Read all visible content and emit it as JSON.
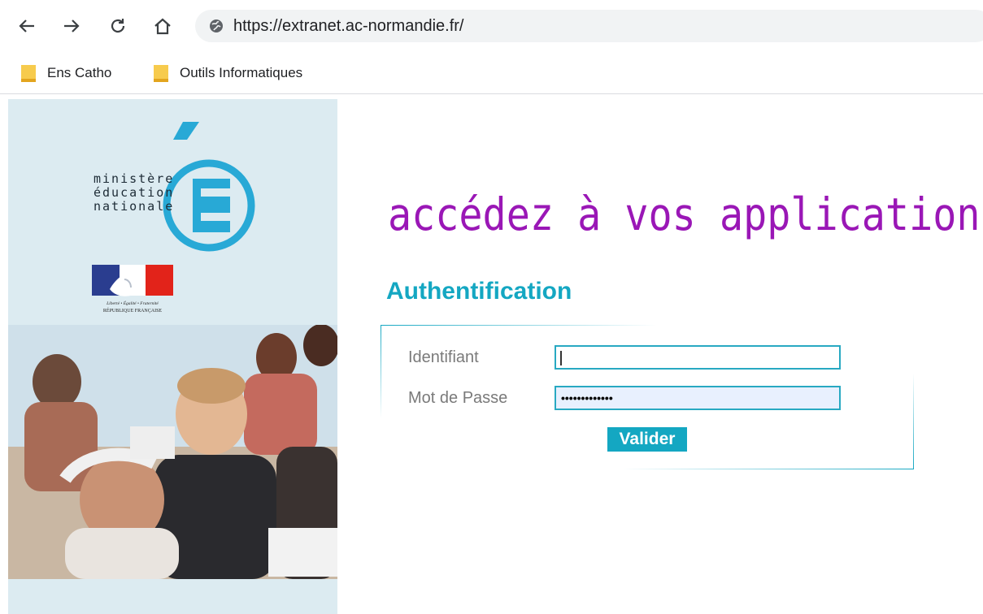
{
  "browser": {
    "url": "https://extranet.ac-normandie.fr/",
    "nav_icons": [
      "back-arrow-icon",
      "forward-arrow-icon",
      "reload-icon",
      "home-icon"
    ],
    "site_icon": "page-info-icon"
  },
  "bookmarks": [
    {
      "label": "Ens Catho",
      "icon": "folder-icon"
    },
    {
      "label": "Outils Informatiques",
      "icon": "folder-icon"
    }
  ],
  "logo": {
    "lines": [
      "ministère",
      "éducation",
      "nationale"
    ],
    "letter": "É",
    "republique": {
      "motto": "Liberté • Égalité • Fraternité",
      "name": "RÉPUBLIQUE FRANÇAISE"
    }
  },
  "main": {
    "headline": "accédez à vos applications",
    "auth_title": "Authentification",
    "form": {
      "username_label": "Identifiant",
      "username_value": "",
      "password_label": "Mot de Passe",
      "password_value": "•••••••••••••",
      "submit_label": "Valider"
    }
  },
  "colors": {
    "headline": "#9a17b6",
    "accent": "#14a7c2",
    "panel_bg": "#dcebf1",
    "logo_blue": "#28a9d6"
  }
}
